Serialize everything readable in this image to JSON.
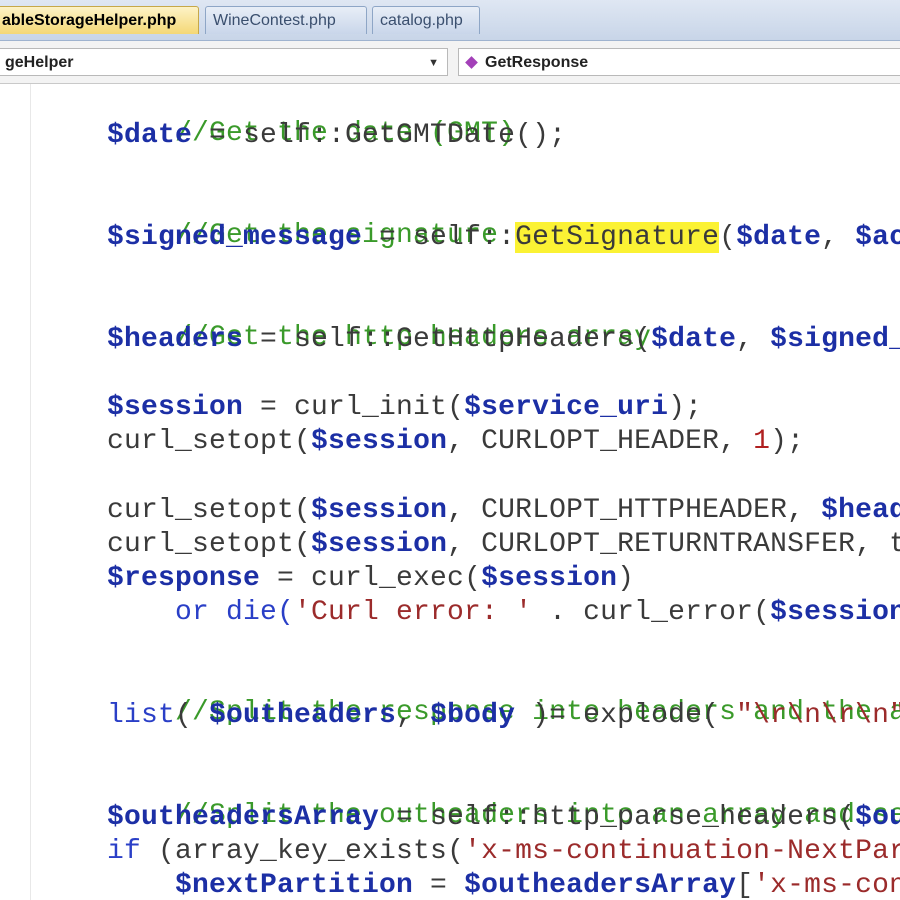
{
  "tabs": [
    {
      "label": "ableStorageHelper.php",
      "active": true
    },
    {
      "label": "WineContest.php",
      "active": false
    },
    {
      "label": "catalog.php",
      "active": false
    }
  ],
  "nav": {
    "class_combo": "geHelper",
    "member_combo": "GetResponse"
  },
  "code": {
    "l1": "//Get the date (GMT)",
    "l2_var": "$date",
    "l2_rest": " = self::GetGMTDate();",
    "l3": "//Get the signature",
    "l4_var": "$signed_message",
    "l4_mid": " = self::",
    "l4_hl": "GetSignature",
    "l4_open": "(",
    "l4_var2": "$date",
    "l4_comma": ", ",
    "l4_var3": "$ac",
    "l5": "//Get the http headers array",
    "l6_var": "$headers",
    "l6_mid": " = self::GetHttpHeaders(",
    "l6_var2": "$date",
    "l6_comma": ", ",
    "l6_var3": "$signed_",
    "l7_var": "$session",
    "l7_mid": " = curl_init(",
    "l7_var2": "$service_uri",
    "l7_end": ");",
    "l8_a": "curl_setopt(",
    "l8_var": "$session",
    "l8_mid": ", CURLOPT_HEADER, ",
    "l8_num": "1",
    "l8_end": ");",
    "l9_a": "curl_setopt(",
    "l9_var": "$session",
    "l9_mid": ", CURLOPT_HTTPHEADER, ",
    "l9_var2": "$head",
    "l10_a": "curl_setopt(",
    "l10_var": "$session",
    "l10_mid": ", CURLOPT_RETURNTRANSFER, t",
    "l11_var": "$response",
    "l11_mid": " = curl_exec(",
    "l11_var2": "$session",
    "l11_end": ")",
    "l12_kw": "or",
    "l12_fn": " die(",
    "l12_str": "'Curl error: '",
    "l12_mid": " . curl_error(",
    "l12_var": "$session",
    "l13": "//Split the response into headers and the actua",
    "l14_kw": "list",
    "l14_a": "( ",
    "l14_var": "$outheaders",
    "l14_comma": ", ",
    "l14_var2": "$body",
    "l14_mid": " )= explode( ",
    "l14_str": "\"\\r\\n\\r\\n\"",
    "l15": "//Split the outheaders into an array and set th",
    "l16_var": "$outheadersArray",
    "l16_mid": " = self::http_parse_headers(",
    "l16_var2": "$ou",
    "l17_kw": "if",
    "l17_mid": " (array_key_exists(",
    "l17_str": "'x-ms-continuation-NextPar",
    "l18_var": "$nextPartition",
    "l18_mid": " = ",
    "l18_var2": "$outheadersArray",
    "l18_open": "[",
    "l18_str": "'x-ms-con"
  },
  "colors": {
    "comment": "#3a9a2a",
    "variable": "#1c2fa5",
    "keyword": "#2a3fc7",
    "string": "#9b2b2b",
    "number": "#b02020",
    "highlight": "#fbf234",
    "active_tab": "#f4d876"
  },
  "icons": {
    "member": "method-icon",
    "dropdown": "chevron-down-icon"
  }
}
